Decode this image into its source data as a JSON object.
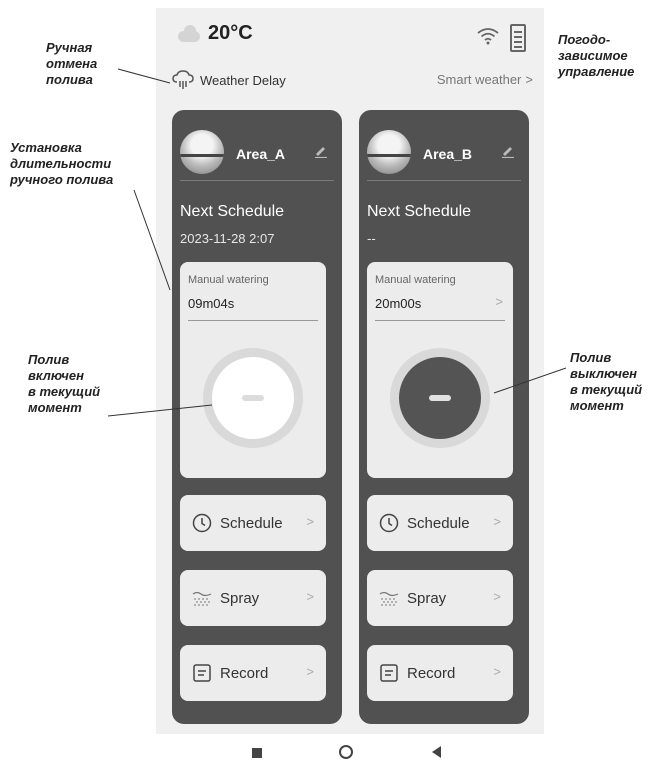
{
  "status": {
    "temperature": "20°C",
    "weather_icon": "cloud-icon",
    "wifi_icon": "wifi-icon",
    "battery_icon": "battery-icon"
  },
  "header": {
    "weather_delay_label": "Weather Delay",
    "smart_weather_label": "Smart weather",
    "smart_weather_chevron": ">"
  },
  "zones": [
    {
      "name": "Area_A",
      "next_schedule_label": "Next Schedule",
      "next_schedule_value": "2023-11-28 2:07",
      "manual_label": "Manual watering",
      "manual_value": "09m04s",
      "watering_on": true,
      "buttons": {
        "schedule": "Schedule",
        "spray": "Spray",
        "record": "Record"
      }
    },
    {
      "name": "Area_B",
      "next_schedule_label": "Next Schedule",
      "next_schedule_value": "--",
      "manual_label": "Manual watering",
      "manual_value": "20m00s",
      "manual_chevron": ">",
      "watering_on": false,
      "buttons": {
        "schedule": "Schedule",
        "spray": "Spray",
        "record": "Record"
      }
    }
  ],
  "annotations": {
    "manual_cancel": "Ручная\nотмена\nполива",
    "duration": "Установка\nдлительности\nручного полива",
    "watering_on": "Полив\nвключен\nв текущий\nмомент",
    "smart_control": "Погодо-\nзависимое\nуправление",
    "watering_off": "Полив\nвыключен\nв текущий\nмомент"
  },
  "colors": {
    "card_bg": "#515151",
    "panel_bg": "#ececec",
    "screen_bg": "#f0f0f0"
  }
}
